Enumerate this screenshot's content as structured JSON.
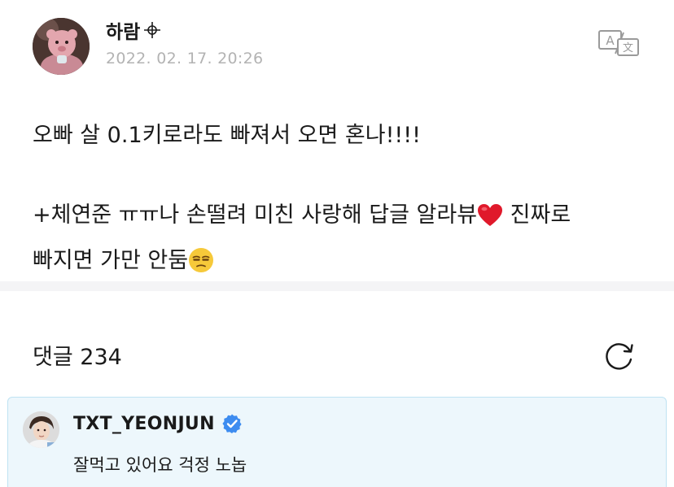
{
  "post": {
    "author": "하람",
    "date": "2022. 02. 17. 20:26",
    "line1": "오빠 살 0.1키로라도 빠져서 오면 혼나!!!!",
    "line2a": "+체연준 ㅠㅠ나 손떨려 미친 사랑해 답글 알라뷰",
    "line2b": "진짜로",
    "line3": "빠지면 가만 안둠"
  },
  "comments": {
    "title": "댓글 234",
    "highlighted": {
      "author": "TXT_YEONJUN",
      "text": "잘먹고 있어요 걱정 노놉"
    }
  },
  "icons": {
    "translate": "translate-icon",
    "refresh": "refresh-icon",
    "verified": "verified-badge-icon",
    "heart": "red-heart-emoji",
    "unamused": "unamused-face-emoji"
  },
  "colors": {
    "date": "#b3b3b3",
    "verified": "#3d8cf0",
    "highlight_bg": "#edf7fc",
    "highlight_border": "#bfe3f3"
  }
}
